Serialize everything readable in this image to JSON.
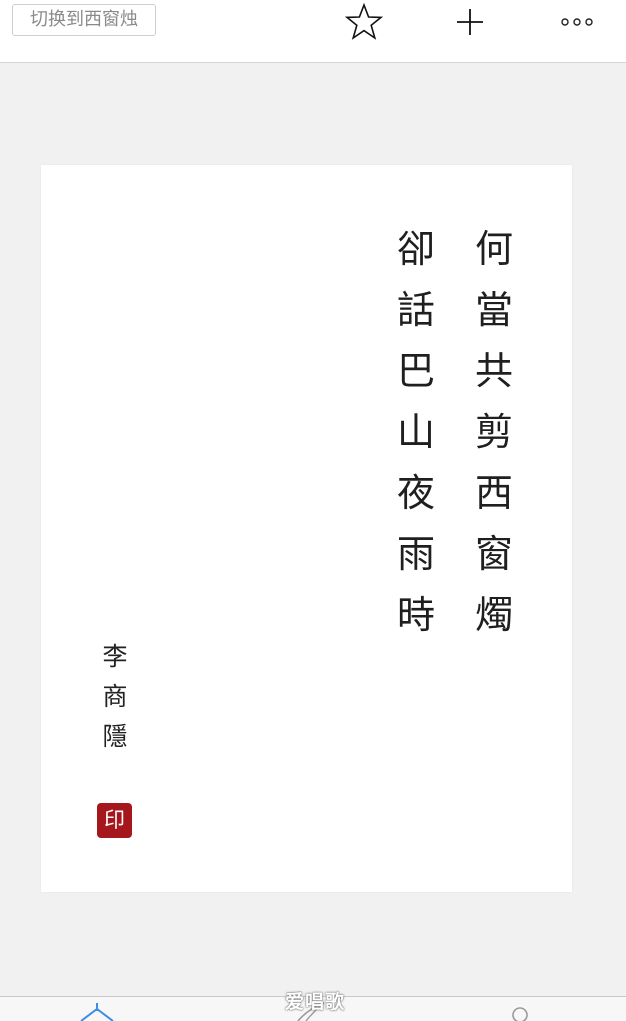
{
  "toolbar": {
    "switch_button_label": "切换到西窗烛",
    "icons": [
      "star-icon",
      "plus-icon",
      "more-icon"
    ]
  },
  "poem": {
    "column_1": [
      "何",
      "當",
      "共",
      "剪",
      "西",
      "窗",
      "燭"
    ],
    "column_2": [
      "卻",
      "話",
      "巴",
      "山",
      "夜",
      "雨",
      "時"
    ],
    "author": [
      "李",
      "商",
      "隱"
    ],
    "seal": "印"
  },
  "bottom_bar": {
    "tabs": [
      "home-tab",
      "write-tab",
      "profile-tab"
    ],
    "accent_color": "#3a8ee6"
  },
  "watermark": "爱唱歌",
  "colors": {
    "seal": "#a5171d",
    "background": "#f1f1f1",
    "card": "#ffffff"
  }
}
